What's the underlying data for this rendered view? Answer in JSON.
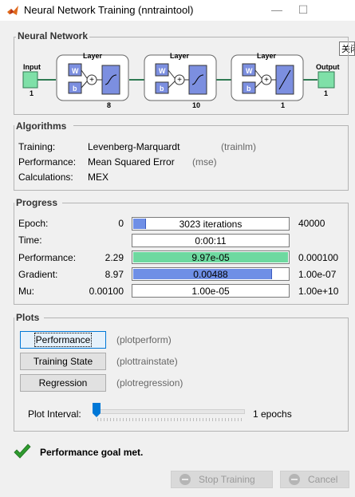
{
  "window": {
    "title": "Neural Network Training (nntraintool)"
  },
  "tooltip": {
    "text": "关闭"
  },
  "network": {
    "title": "Neural Network",
    "input_label": "Input",
    "input_size": "1",
    "output_label": "Output",
    "output_size": "1",
    "layers": [
      {
        "label": "Layer",
        "w": "W",
        "b": "b",
        "size": "8"
      },
      {
        "label": "Layer",
        "w": "W",
        "b": "b",
        "size": "10"
      },
      {
        "label": "Layer",
        "w": "W",
        "b": "b",
        "size": "1"
      }
    ]
  },
  "algorithms": {
    "title": "Algorithms",
    "rows": [
      {
        "label": "Training:",
        "value": "Levenberg-Marquardt",
        "code": "(trainlm)"
      },
      {
        "label": "Performance:",
        "value": "Mean Squared Error",
        "code": "(mse)"
      },
      {
        "label": "Calculations:",
        "value": "MEX",
        "code": ""
      }
    ]
  },
  "progress": {
    "title": "Progress",
    "rows": [
      {
        "label": "Epoch:",
        "start": "0",
        "value": "3023 iterations",
        "end": "40000",
        "fill": 0.0756,
        "color": "#6f8fe6"
      },
      {
        "label": "Time:",
        "start": "",
        "value": "0:00:11",
        "end": "",
        "fill": 0,
        "color": "#6f8fe6"
      },
      {
        "label": "Performance:",
        "start": "2.29",
        "value": "9.97e-05",
        "end": "0.000100",
        "fill": 1.0,
        "color": "#6ed9a0"
      },
      {
        "label": "Gradient:",
        "start": "8.97",
        "value": "0.00488",
        "end": "1.00e-07",
        "fill": 0.89,
        "color": "#6f8fe6"
      },
      {
        "label": "Mu:",
        "start": "0.00100",
        "value": "1.00e-05",
        "end": "1.00e+10",
        "fill": 0,
        "color": "#6f8fe6"
      }
    ]
  },
  "plots": {
    "title": "Plots",
    "buttons": [
      {
        "label": "Performance",
        "code": "(plotperform)"
      },
      {
        "label": "Training State",
        "code": "(plottrainstate)"
      },
      {
        "label": "Regression",
        "code": "(plotregression)"
      }
    ],
    "interval_label": "Plot Interval:",
    "interval_value": "1 epochs"
  },
  "status": {
    "text": "Performance goal met."
  },
  "actions": {
    "stop_label": "Stop Training",
    "cancel_label": "Cancel"
  },
  "colors": {
    "accent_green": "#2e9b2e",
    "bar_blue": "#6f8fe6",
    "bar_green": "#6ed9a0"
  }
}
